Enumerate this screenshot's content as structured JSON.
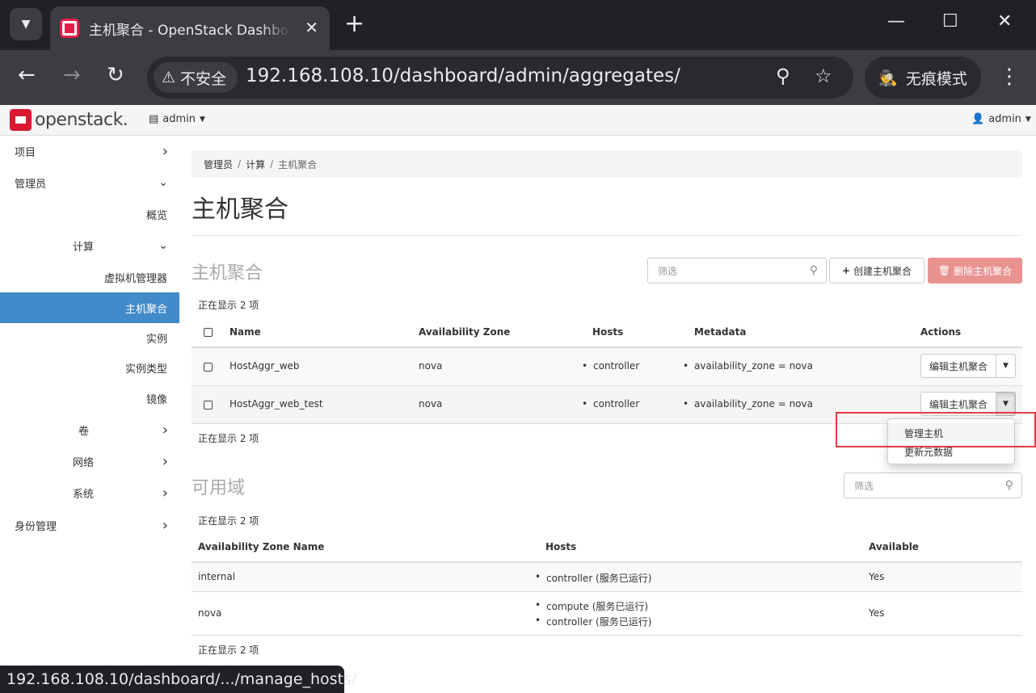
{
  "browser": {
    "tab_title": "主机聚合 - OpenStack Dashboard",
    "insecure_label": "不安全",
    "url": "192.168.108.10/dashboard/admin/aggregates/",
    "incognito_label": "无痕模式",
    "status_url": "192.168.108.10/dashboard/.../manage_hosts/"
  },
  "topnav": {
    "logo_text": "openstack.",
    "project": "admin",
    "user": "admin"
  },
  "sidebar": {
    "items": [
      {
        "label": "项目"
      },
      {
        "label": "管理员"
      },
      {
        "label": "概览"
      },
      {
        "label": "计算"
      },
      {
        "label": "虚拟机管理器"
      },
      {
        "label": "主机聚合"
      },
      {
        "label": "实例"
      },
      {
        "label": "实例类型"
      },
      {
        "label": "镜像"
      },
      {
        "label": "卷"
      },
      {
        "label": "网络"
      },
      {
        "label": "系统"
      },
      {
        "label": "身份管理"
      }
    ]
  },
  "breadcrumb": [
    "管理员",
    "计算",
    "主机聚合"
  ],
  "page_title": "主机聚合",
  "aggregates": {
    "heading": "主机聚合",
    "filter_placeholder": "筛选",
    "create_label": "创建主机聚合",
    "delete_label": "删除主机聚合",
    "count_text": "正在显示 2 项",
    "columns": [
      "Name",
      "Availability Zone",
      "Hosts",
      "Metadata",
      "Actions"
    ],
    "rows": [
      {
        "name": "HostAggr_web",
        "zone": "nova",
        "host": "controller",
        "metadata": "availability_zone = nova",
        "action": "编辑主机聚合"
      },
      {
        "name": "HostAggr_web_test",
        "zone": "nova",
        "host": "controller",
        "metadata": "availability_zone = nova",
        "action": "编辑主机聚合"
      }
    ],
    "dropdown_items": [
      "管理主机",
      "更新元数据"
    ]
  },
  "zones": {
    "heading": "可用域",
    "filter_placeholder": "筛选",
    "count_text": "正在显示 2 项",
    "columns": [
      "Availability Zone Name",
      "Hosts",
      "Available"
    ],
    "rows": [
      {
        "name": "internal",
        "hosts": [
          "controller (服务已运行)"
        ],
        "available": "Yes"
      },
      {
        "name": "nova",
        "hosts": [
          "compute (服务已运行)",
          "controller (服务已运行)"
        ],
        "available": "Yes"
      }
    ]
  },
  "colors": {
    "active_nav": "#428bca",
    "danger_button": "#e99391",
    "highlight_box": "#e63946"
  }
}
